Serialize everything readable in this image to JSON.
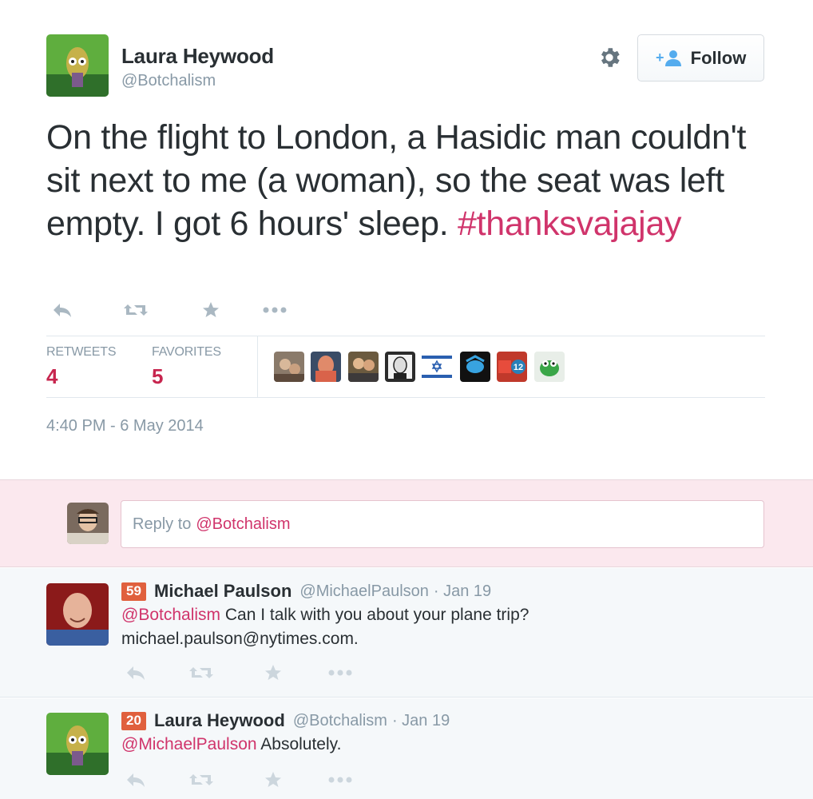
{
  "tweet": {
    "author_name": "Laura Heywood",
    "author_handle": "@Botchalism",
    "follow_label": "Follow",
    "text_main": "On the flight to London, a Hasidic man couldn't sit next to me (a woman), so the seat was left empty. I got 6 hours' sleep.",
    "hashtag": "#thanksvajajay",
    "stats": {
      "retweets_label": "RETWEETS",
      "retweets_value": "4",
      "favorites_label": "FAVORITES",
      "favorites_value": "5"
    },
    "favoriter_avatars": [
      "avatar-1",
      "avatar-2",
      "avatar-3",
      "avatar-4",
      "avatar-5",
      "avatar-6",
      "avatar-7",
      "avatar-8",
      "avatar-9"
    ],
    "timestamp": "4:40 PM - 6 May 2014"
  },
  "reply_box": {
    "prefix": "Reply to",
    "mention": "@Botchalism"
  },
  "replies": [
    {
      "badge": "59",
      "name": "Michael Paulson",
      "handle": "@MichaelPaulson",
      "date": "· Jan 19",
      "mention": "@Botchalism",
      "text": "Can I talk with you about your plane trip?",
      "text2": "michael.paulson@nytimes.com."
    },
    {
      "badge": "20",
      "name": "Laura Heywood",
      "handle": "@Botchalism",
      "date": "· Jan 19",
      "mention": "@MichaelPaulson",
      "text": "Absolutely."
    }
  ],
  "colors": {
    "accent": "#d0346b",
    "stat_value": "#c7254e",
    "muted": "#8899a6",
    "badge": "#e0603d",
    "reply_area_bg": "#fbe8ee"
  }
}
